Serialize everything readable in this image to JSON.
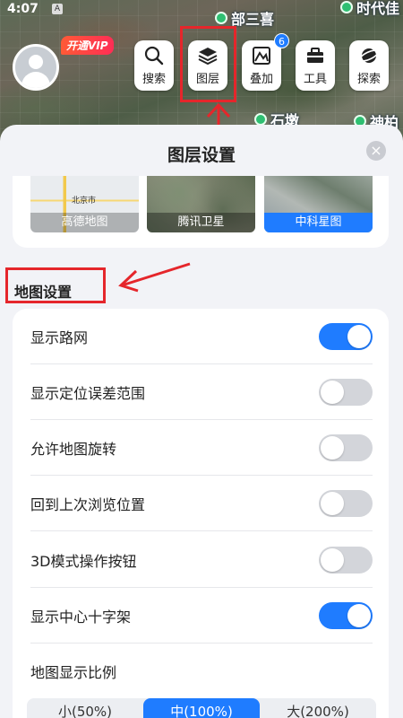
{
  "status": {
    "time": "4:07",
    "indicator": "A"
  },
  "map": {
    "pois": [
      {
        "label": "部三喜"
      },
      {
        "label": "时代佳"
      },
      {
        "label": "石墩"
      },
      {
        "label": "神柏"
      }
    ]
  },
  "profile": {
    "vip_label": "开通VIP"
  },
  "toolbar": {
    "search": "搜索",
    "layers": "图层",
    "overlay": "叠加",
    "overlay_badge": "6",
    "tools": "工具",
    "explore": "探索"
  },
  "sheet": {
    "title": "图层设置",
    "close": "×",
    "layers": [
      {
        "label": "高德地图",
        "selected": false
      },
      {
        "label": "腾讯卫星",
        "selected": false
      },
      {
        "label": "中科星图",
        "selected": true
      }
    ],
    "thumb_city_label": "北京市",
    "section_title": "地图设置",
    "settings": [
      {
        "label": "显示路网",
        "on": true
      },
      {
        "label": "显示定位误差范围",
        "on": false
      },
      {
        "label": "允许地图旋转",
        "on": false
      },
      {
        "label": "回到上次浏览位置",
        "on": false
      },
      {
        "label": "3D模式操作按钮",
        "on": false
      },
      {
        "label": "显示中心十字架",
        "on": true
      }
    ],
    "scale": {
      "label": "地图显示比例",
      "options": [
        "小(50%)",
        "中(100%)",
        "大(200%)"
      ],
      "selected_index": 1
    }
  },
  "colors": {
    "accent": "#1f7cff",
    "annotation_red": "#e5262b",
    "vip": "#ff2d55"
  }
}
